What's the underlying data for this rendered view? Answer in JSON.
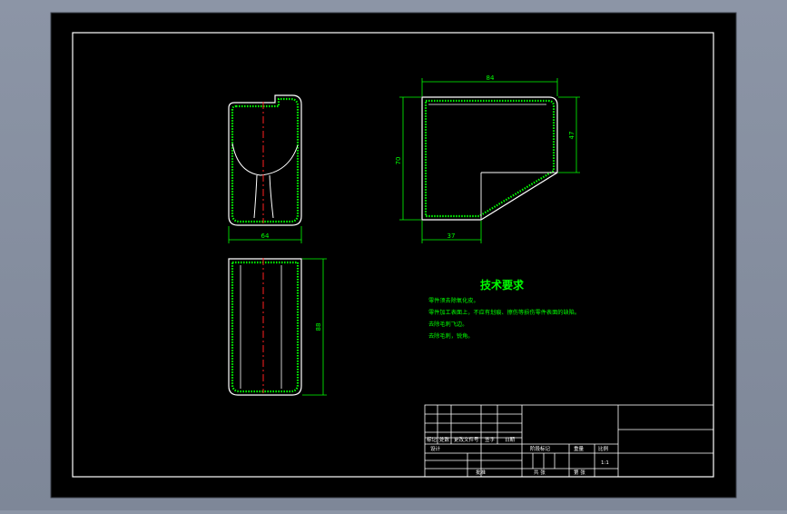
{
  "colors": {
    "background": "#000000",
    "border": "#ffffff",
    "part_outline": "#ffffff",
    "hatch": "#00ff00",
    "centerline": "#ff2020",
    "dimension": "#00ff00",
    "notes": "#00ff00",
    "title_block": "#ffffff"
  },
  "dimensions": {
    "front_width": "64",
    "top_width": "84",
    "top_height": "70",
    "top_right_height": "47",
    "top_bottom_width": "37",
    "side_height": "88"
  },
  "tech_requirements": {
    "title": "技术要求",
    "items": [
      "零件须去除氧化皮。",
      "零件加工表面上，不应有划痕、擦伤等损伤零件表面的缺陷。",
      "去除毛刺飞边。",
      "去除毛刺，锐角。"
    ]
  },
  "title_block": {
    "labels": {
      "mark": "标记",
      "count": "处数",
      "file_no": "更改文件号",
      "sign": "签字",
      "date": "日期",
      "design": "设计",
      "stage_mark": "阶段标记",
      "weight": "重量",
      "scale": "比例",
      "scale_value": "1:1",
      "approve": "批准",
      "sheet_total": "共 张",
      "sheet": "第 张"
    }
  }
}
